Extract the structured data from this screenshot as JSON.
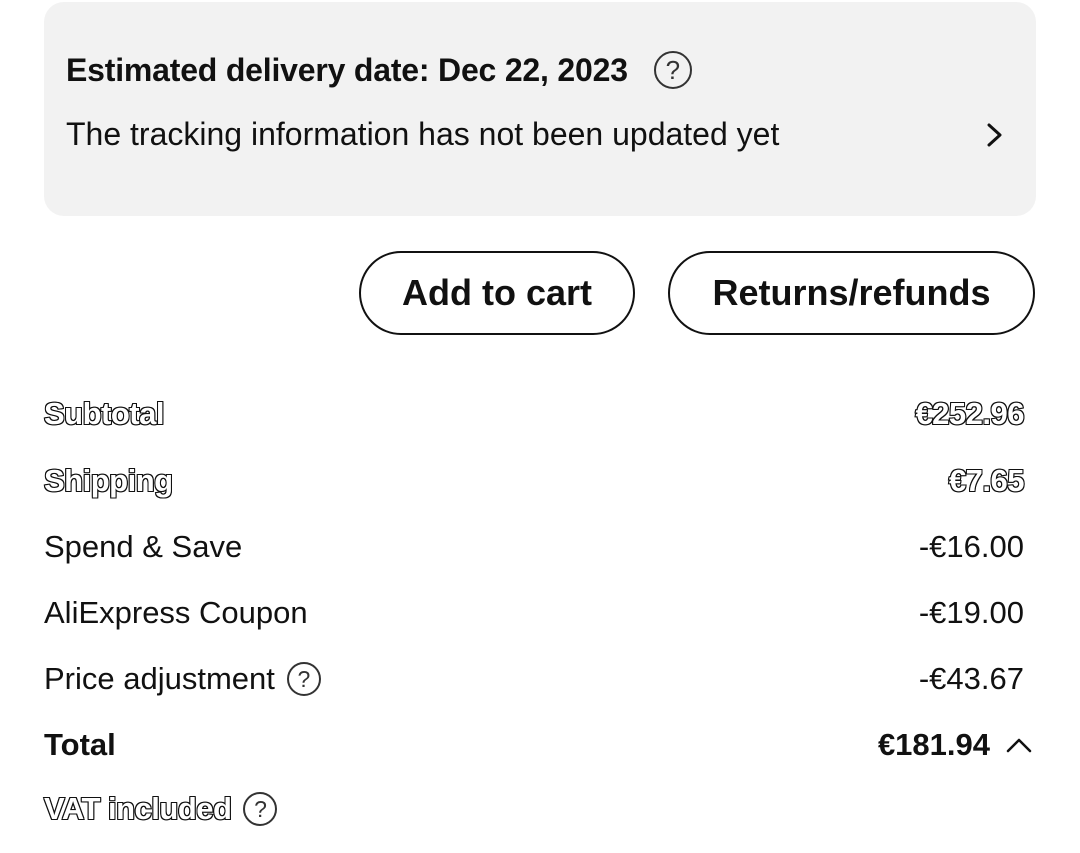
{
  "delivery": {
    "title": "Estimated delivery date: Dec 22, 2023",
    "help_glyph": "?",
    "tracking_text": "The tracking information has not been updated yet",
    "chevron_icon": "chevron-right-icon"
  },
  "actions": {
    "add_to_cart": "Add to cart",
    "returns_refunds": "Returns/refunds"
  },
  "summary": {
    "subtotal_label": "Subtotal",
    "subtotal_value": "€252.96",
    "shipping_label": "Shipping",
    "shipping_value": "€7.65",
    "spend_save_label": "Spend & Save",
    "spend_save_value": "-€16.00",
    "coupon_label": "AliExpress Coupon",
    "coupon_value": "-€19.00",
    "price_adjustment_label": "Price adjustment",
    "price_adjustment_value": "-€43.67",
    "total_label": "Total",
    "total_value": "€181.94",
    "vat_label": "VAT included",
    "help_glyph": "?"
  },
  "colors": {
    "card_background": "#f2f2f2",
    "text": "#111111",
    "border": "#111111"
  }
}
